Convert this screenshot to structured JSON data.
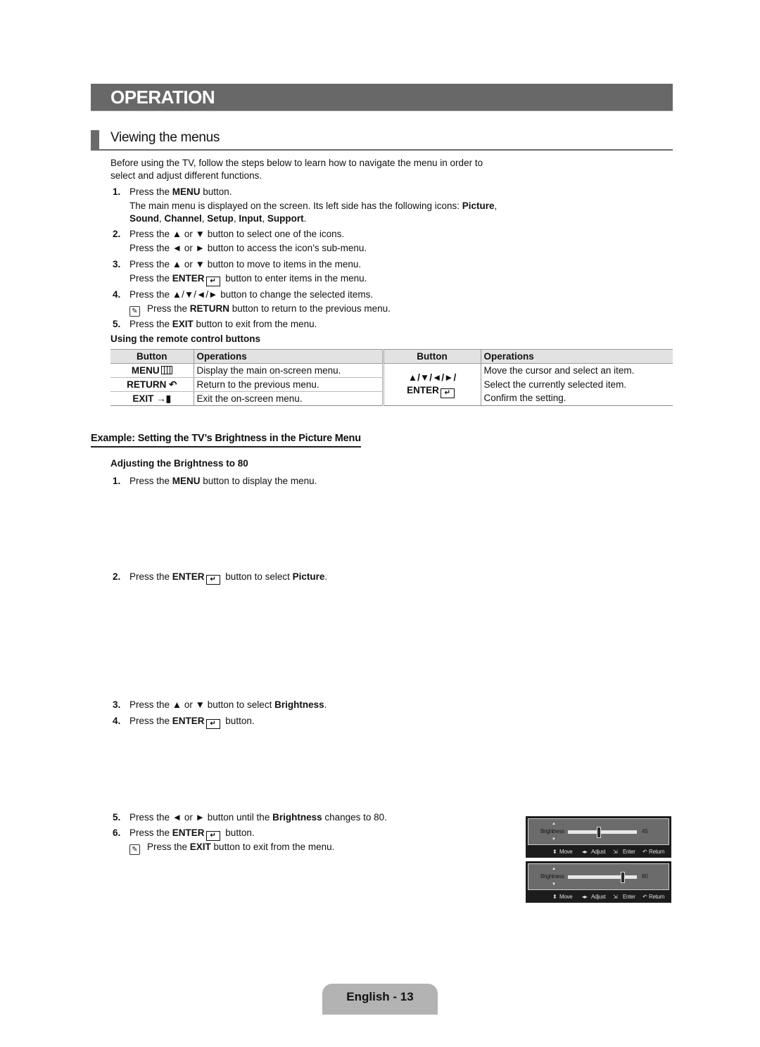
{
  "banner": {
    "title": "OPERATION"
  },
  "section": {
    "title": "Viewing the menus"
  },
  "intro": {
    "line1": "Before using the TV, follow the steps below to learn how to navigate the menu in order to",
    "line2": "select and adjust different functions."
  },
  "steps": [
    {
      "num": "1.",
      "pre": "Press the ",
      "bold": "MENU",
      "post": " button."
    },
    {
      "num": "2.",
      "text": "Press the ▲ or ▼ button to select one of the icons.",
      "text2": "Press the ◄ or ► button to access the icon’s sub-menu."
    },
    {
      "num": "3.",
      "text": "Press the ▲ or ▼ button to move to items in the menu.",
      "pre2": "Press the ",
      "bold2": "ENTER",
      "post2": " button to enter items in the menu."
    },
    {
      "num": "4.",
      "text": "Press the ▲/▼/◄/► button to change the selected items.",
      "note_pre": "Press the ",
      "note_bold": "RETURN",
      "note_post": " button to return to the previous menu."
    },
    {
      "num": "5.",
      "pre": "Press the ",
      "bold": "EXIT",
      "post": " button to exit from the menu."
    }
  ],
  "step1_desc": {
    "pre": "The main menu is displayed on the screen. Its left side has the following icons: ",
    "icons": [
      "Picture",
      "Sound",
      "Channel",
      "Setup",
      "Input",
      "Support"
    ]
  },
  "remote_table": {
    "caption": "Using the remote control buttons",
    "headers": {
      "button": "Button",
      "operations": "Operations"
    },
    "left_rows": [
      {
        "button": "MENU",
        "icon": "menu-grid-icon",
        "glyph": "▥",
        "operation": "Display the main on-screen menu."
      },
      {
        "button": "RETURN",
        "icon": "return-icon",
        "glyph": "↶",
        "operation": "Return to the previous menu."
      },
      {
        "button": "EXIT",
        "icon": "exit-icon",
        "glyph": "→▮",
        "operation": "Exit the on-screen menu."
      }
    ],
    "right_button_line1": "▲/▼/◄/►/",
    "right_button_line2": "ENTER",
    "right_rows": [
      {
        "operation": "Move the cursor and select an item."
      },
      {
        "operation": "Select the currently selected item."
      },
      {
        "operation": "Confirm the setting."
      }
    ]
  },
  "example": {
    "title": "Example: Setting the TV’s Brightness in the Picture Menu",
    "subtitle": "Adjusting the Brightness to 80",
    "steps": [
      {
        "num": "1.",
        "pre": "Press the ",
        "bold": "MENU",
        "post": " button to display the menu."
      },
      {
        "num": "2.",
        "pre": "Press the ",
        "bold": "ENTER",
        "post": " button to select ",
        "bold_end": "Picture",
        "end": "."
      },
      {
        "num": "3.",
        "pre": "Press the ▲ or ▼ button to select ",
        "bold": "Brightness",
        "post": "."
      },
      {
        "num": "4.",
        "pre": "Press the ",
        "bold": "ENTER",
        "post": " button."
      },
      {
        "num": "5.",
        "pre": "Press the ◄ or ► button until the ",
        "bold": "Brightness",
        "post": " changes to 80."
      },
      {
        "num": "6.",
        "pre": "Press the ",
        "bold": "ENTER",
        "post": " button."
      }
    ],
    "note": {
      "pre": "Press the ",
      "bold": "EXIT",
      "post": " button to exit from the menu."
    }
  },
  "osd_panels": [
    {
      "label": "Brightness",
      "value": "45",
      "level": 45,
      "max": 100,
      "footer": {
        "move": "Move",
        "adjust": "Adjust",
        "enter": "Enter",
        "return": "Return"
      }
    },
    {
      "label": "Brightness",
      "value": "80",
      "level": 80,
      "max": 100,
      "footer": {
        "move": "Move",
        "adjust": "Adjust",
        "enter": "Enter",
        "return": "Return"
      }
    }
  ],
  "footer": {
    "page_label": "English - 13"
  }
}
